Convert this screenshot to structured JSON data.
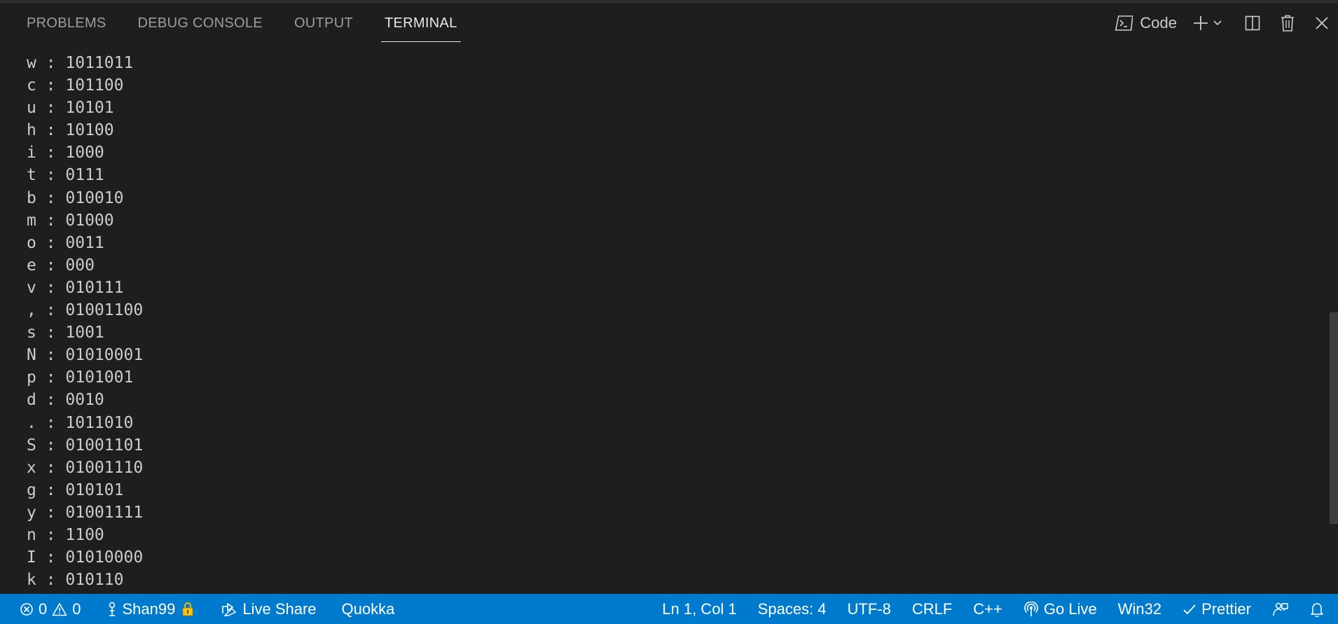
{
  "panel": {
    "tabs": [
      {
        "label": "PROBLEMS",
        "active": false
      },
      {
        "label": "DEBUG CONSOLE",
        "active": false
      },
      {
        "label": "OUTPUT",
        "active": false
      },
      {
        "label": "TERMINAL",
        "active": true
      }
    ],
    "actions": {
      "terminal_profile": "Code",
      "icons": [
        "terminal-icon",
        "plus-icon",
        "chevron-down-icon",
        "split-icon",
        "trash-icon",
        "close-icon"
      ]
    }
  },
  "terminal": {
    "lines": [
      "w : 1011011",
      "c : 101100",
      "u : 10101",
      "h : 10100",
      "i : 1000",
      "t : 0111",
      "b : 010010",
      "m : 01000",
      "o : 0011",
      "e : 000",
      "v : 010111",
      ", : 01001100",
      "s : 1001",
      "N : 01010001",
      "p : 0101001",
      "d : 0010",
      ". : 1011010",
      "S : 01001101",
      "x : 01001110",
      "g : 010101",
      "y : 01001111",
      "n : 1100",
      "I : 01010000",
      "k : 010110"
    ]
  },
  "statusbar": {
    "errors": "0",
    "warnings": "0",
    "user": "Shan99",
    "live_share": "Live Share",
    "quokka": "Quokka",
    "position": "Ln 1, Col 1",
    "spaces": "Spaces: 4",
    "encoding": "UTF-8",
    "eol": "CRLF",
    "language": "C++",
    "go_live": "Go Live",
    "platform": "Win32",
    "prettier": "Prettier"
  },
  "colors": {
    "background": "#1e1e1e",
    "statusbar": "#007acc",
    "text": "#cccccc",
    "tab_inactive": "#9d9d9d",
    "tab_active": "#e7e7e7"
  }
}
